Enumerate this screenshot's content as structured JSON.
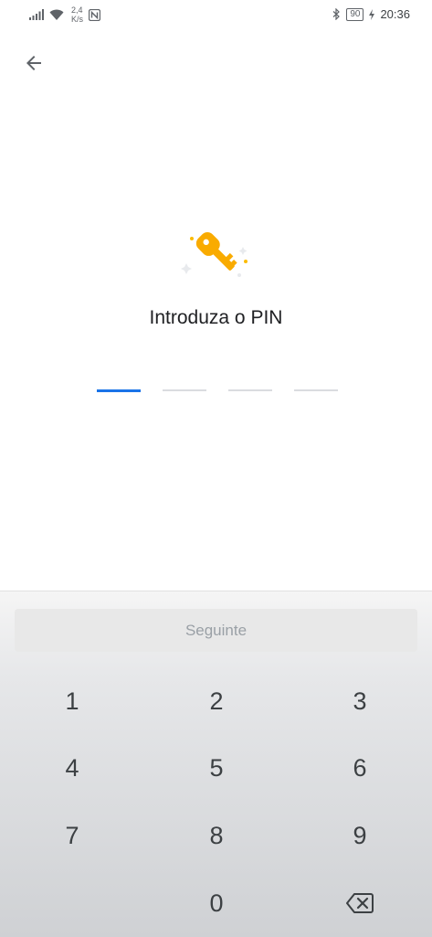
{
  "status_bar": {
    "speed_value": "2,4",
    "speed_unit": "K/s",
    "battery": "90",
    "time": "20:36"
  },
  "title": "Introduza o PIN",
  "pin": {
    "length": 4,
    "filled": 0
  },
  "keypad": {
    "next_label": "Seguinte",
    "keys": [
      "1",
      "2",
      "3",
      "4",
      "5",
      "6",
      "7",
      "8",
      "9",
      "0"
    ]
  },
  "colors": {
    "accent": "#1a73e8",
    "key_icon": "#f9ab00"
  }
}
